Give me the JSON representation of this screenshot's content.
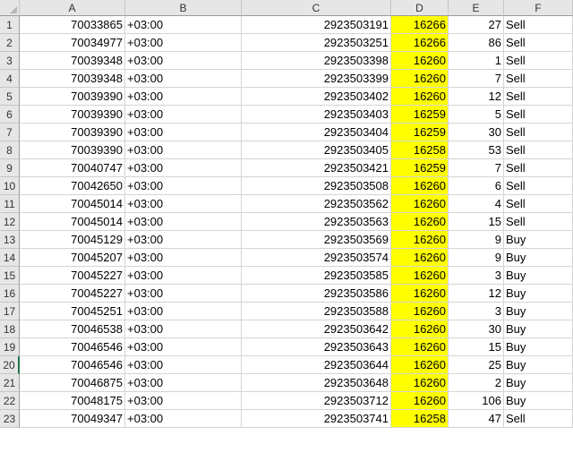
{
  "sheet": {
    "columns": [
      "A",
      "B",
      "C",
      "D",
      "E",
      "F"
    ],
    "highlight_color": "#ffff00",
    "rows": [
      {
        "num": "1",
        "a": "70033865",
        "b": "+03:00",
        "c": "2923503191",
        "d": "16266",
        "e": "27",
        "f": "Sell"
      },
      {
        "num": "2",
        "a": "70034977",
        "b": "+03:00",
        "c": "2923503251",
        "d": "16266",
        "e": "86",
        "f": "Sell"
      },
      {
        "num": "3",
        "a": "70039348",
        "b": "+03:00",
        "c": "2923503398",
        "d": "16260",
        "e": "1",
        "f": "Sell"
      },
      {
        "num": "4",
        "a": "70039348",
        "b": "+03:00",
        "c": "2923503399",
        "d": "16260",
        "e": "7",
        "f": "Sell"
      },
      {
        "num": "5",
        "a": "70039390",
        "b": "+03:00",
        "c": "2923503402",
        "d": "16260",
        "e": "12",
        "f": "Sell"
      },
      {
        "num": "6",
        "a": "70039390",
        "b": "+03:00",
        "c": "2923503403",
        "d": "16259",
        "e": "5",
        "f": "Sell"
      },
      {
        "num": "7",
        "a": "70039390",
        "b": "+03:00",
        "c": "2923503404",
        "d": "16259",
        "e": "30",
        "f": "Sell"
      },
      {
        "num": "8",
        "a": "70039390",
        "b": "+03:00",
        "c": "2923503405",
        "d": "16258",
        "e": "53",
        "f": "Sell"
      },
      {
        "num": "9",
        "a": "70040747",
        "b": "+03:00",
        "c": "2923503421",
        "d": "16259",
        "e": "7",
        "f": "Sell"
      },
      {
        "num": "10",
        "a": "70042650",
        "b": "+03:00",
        "c": "2923503508",
        "d": "16260",
        "e": "6",
        "f": "Sell"
      },
      {
        "num": "11",
        "a": "70045014",
        "b": "+03:00",
        "c": "2923503562",
        "d": "16260",
        "e": "4",
        "f": "Sell"
      },
      {
        "num": "12",
        "a": "70045014",
        "b": "+03:00",
        "c": "2923503563",
        "d": "16260",
        "e": "15",
        "f": "Sell"
      },
      {
        "num": "13",
        "a": "70045129",
        "b": "+03:00",
        "c": "2923503569",
        "d": "16260",
        "e": "9",
        "f": "Buy"
      },
      {
        "num": "14",
        "a": "70045207",
        "b": "+03:00",
        "c": "2923503574",
        "d": "16260",
        "e": "9",
        "f": "Buy"
      },
      {
        "num": "15",
        "a": "70045227",
        "b": "+03:00",
        "c": "2923503585",
        "d": "16260",
        "e": "3",
        "f": "Buy"
      },
      {
        "num": "16",
        "a": "70045227",
        "b": "+03:00",
        "c": "2923503586",
        "d": "16260",
        "e": "12",
        "f": "Buy"
      },
      {
        "num": "17",
        "a": "70045251",
        "b": "+03:00",
        "c": "2923503588",
        "d": "16260",
        "e": "3",
        "f": "Buy"
      },
      {
        "num": "18",
        "a": "70046538",
        "b": "+03:00",
        "c": "2923503642",
        "d": "16260",
        "e": "30",
        "f": "Buy"
      },
      {
        "num": "19",
        "a": "70046546",
        "b": "+03:00",
        "c": "2923503643",
        "d": "16260",
        "e": "15",
        "f": "Buy"
      },
      {
        "num": "20",
        "a": "70046546",
        "b": "+03:00",
        "c": "2923503644",
        "d": "16260",
        "e": "25",
        "f": "Buy"
      },
      {
        "num": "21",
        "a": "70046875",
        "b": "+03:00",
        "c": "2923503648",
        "d": "16260",
        "e": "2",
        "f": "Buy"
      },
      {
        "num": "22",
        "a": "70048175",
        "b": "+03:00",
        "c": "2923503712",
        "d": "16260",
        "e": "106",
        "f": "Buy"
      },
      {
        "num": "23",
        "a": "70049347",
        "b": "+03:00",
        "c": "2923503741",
        "d": "16258",
        "e": "47",
        "f": "Sell"
      }
    ]
  }
}
